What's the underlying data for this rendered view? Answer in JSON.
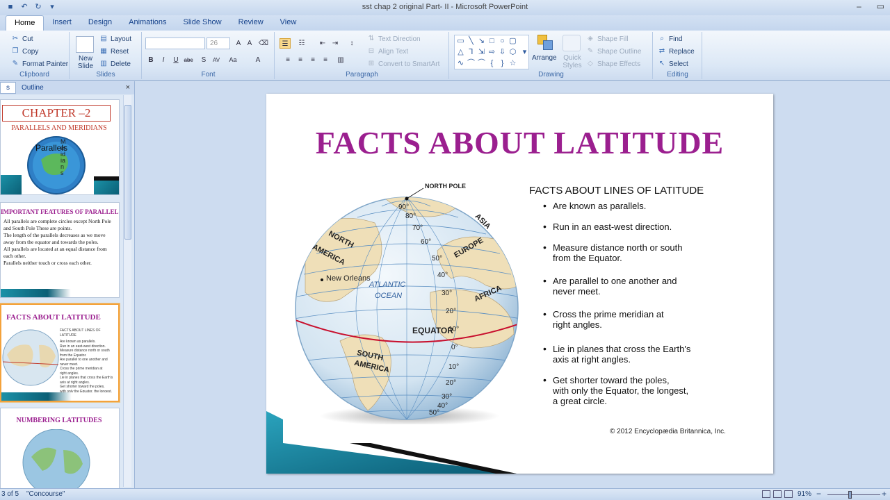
{
  "app": {
    "window_title": "sst chap 2 original Part- II - Microsoft PowerPoint",
    "window_buttons": [
      "–",
      "▭"
    ]
  },
  "tabs": [
    "Home",
    "Insert",
    "Design",
    "Animations",
    "Slide Show",
    "Review",
    "View"
  ],
  "ribbon": {
    "clipboard": {
      "label": "Clipboard",
      "cut": "Cut",
      "copy": "Copy",
      "format_painter": "Format Painter"
    },
    "slides": {
      "label": "Slides",
      "new_slide_1": "New",
      "new_slide_2": "Slide",
      "layout": "Layout",
      "reset": "Reset",
      "delete": "Delete"
    },
    "font": {
      "label": "Font",
      "font_size": "26"
    },
    "paragraph": {
      "label": "Paragraph",
      "text_direction": "Text Direction",
      "align_text": "Align Text",
      "smartart": "Convert to SmartArt"
    },
    "drawing": {
      "label": "Drawing",
      "arrange": "Arrange",
      "quick_styles_1": "Quick",
      "quick_styles_2": "Styles",
      "shape_fill": "Shape Fill",
      "shape_outline": "Shape Outline",
      "shape_effects": "Shape Effects"
    },
    "editing": {
      "label": "Editing",
      "find": "Find",
      "replace": "Replace",
      "select": "Select"
    }
  },
  "panel": {
    "tab_slides": "s",
    "tab_outline": "Outline",
    "close": "×",
    "thumb1": {
      "title": "CHAPTER –2",
      "subtitle": "PARALLELS AND MERIDIANS",
      "overlay_parallels": "Parallels",
      "overlay_meridians": "Meridians"
    },
    "thumb2": {
      "title": "IMPORTANT FEATURES OF PARALLELS",
      "bullets": [
        "All parallels are complete circles except North Pole and South Pole These are points.",
        "The length of the parallels decreases as we move away from the equator and towards the poles.",
        "All parallels are located at an equal distance from each other.",
        "Parallels neither touch or cross each other."
      ]
    },
    "thumb3": {
      "title": "FACTS ABOUT LATITUDE"
    },
    "thumb4": {
      "title": "NUMBERING LATITUDES"
    }
  },
  "slide": {
    "title": "FACTS ABOUT LATITUDE",
    "facts_heading": "FACTS ABOUT LINES OF LATITUDE",
    "facts": [
      [
        "Are known as parallels."
      ],
      [
        "Run in an east-west direction."
      ],
      [
        "Measure distance north or south",
        "from the Equator."
      ],
      [
        "Are parallel to one another and",
        "never meet."
      ],
      [
        "Cross the prime meridian at",
        "right angles."
      ],
      [
        "Lie in planes that cross the Earth's",
        "axis at right angles."
      ],
      [
        "Get shorter toward the poles,",
        "with only the Equator, the longest,",
        "a great circle."
      ]
    ],
    "copyright": "© 2012 Encyclopædia Britannica, Inc.",
    "globe": {
      "north_pole": "NORTH POLE",
      "equator": "EQUATOR",
      "atlantic": "ATLANTIC",
      "ocean": "OCEAN",
      "north": "NORTH",
      "america": "AMERICA",
      "south": "SOUTH",
      "south_america": "AMERICA",
      "europe": "EUROPE",
      "asia": "ASIA",
      "africa": "AFRICA",
      "new_orleans": "New Orleans",
      "lat_labels": [
        "90°",
        "80°",
        "70°",
        "60°",
        "50°",
        "40°",
        "30°",
        "20°",
        "10°",
        "0°",
        "10°",
        "20°",
        "30°",
        "40°",
        "50°"
      ]
    }
  },
  "status": {
    "slide_count": "3 of 5",
    "theme": "\"Concourse\"",
    "zoom": "91%",
    "zoom_minus": "−",
    "zoom_plus": "+"
  }
}
